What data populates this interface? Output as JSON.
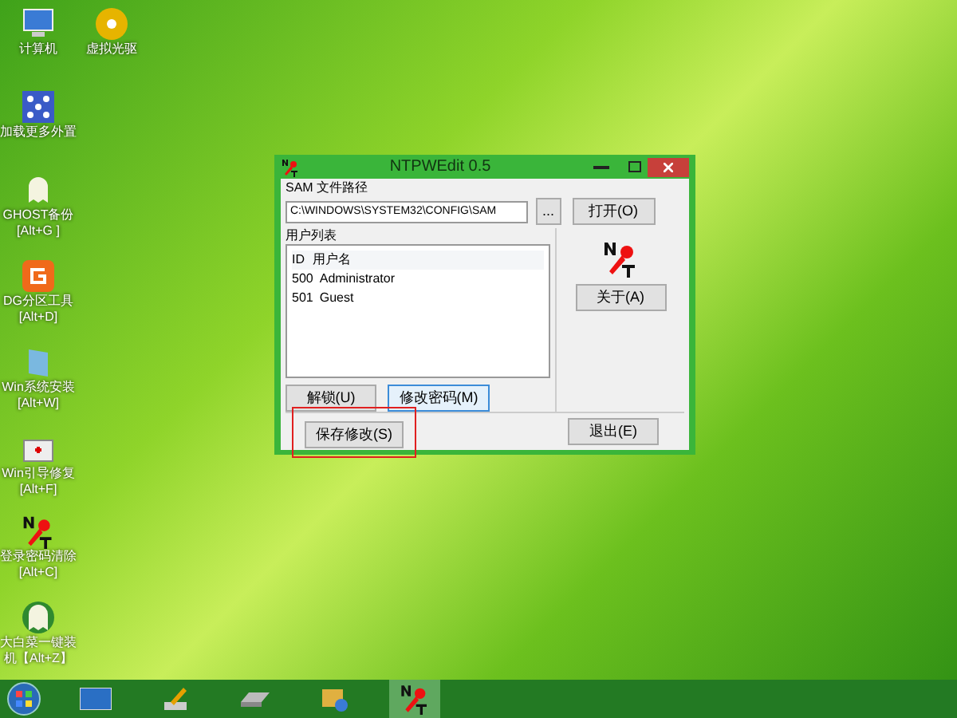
{
  "desktop_icons": [
    {
      "kind": "computer",
      "lines": [
        "计算机"
      ]
    },
    {
      "kind": "disc",
      "lines": [
        "虚拟光驱"
      ]
    },
    {
      "kind": "grid",
      "lines": [
        "加载更多外置"
      ]
    },
    {
      "kind": "ghost",
      "lines": [
        "GHOST备份",
        "[Alt+G ]"
      ]
    },
    {
      "kind": "partition",
      "lines": [
        "DG分区工具",
        "[Alt+D]"
      ]
    },
    {
      "kind": "install",
      "lines": [
        "Win系统安装",
        "[Alt+W]"
      ]
    },
    {
      "kind": "repair",
      "lines": [
        "Win引导修复",
        "[Alt+F]"
      ]
    },
    {
      "kind": "ntpw",
      "lines": [
        "登录密码清除",
        "[Alt+C]"
      ]
    },
    {
      "kind": "ghost2",
      "lines": [
        "大白菜一键装",
        "机【Alt+Z】"
      ]
    }
  ],
  "window": {
    "title": "NTPWEdit 0.5",
    "sam_label": "SAM 文件路径",
    "sam_path": "C:\\WINDOWS\\SYSTEM32\\CONFIG\\SAM",
    "browse": "...",
    "open": "打开(O)",
    "user_list_label": "用户列表",
    "columns": [
      "ID",
      "用户名"
    ],
    "rows": [
      {
        "id": "500",
        "name": "Administrator"
      },
      {
        "id": "501",
        "name": "Guest"
      }
    ],
    "unlock": "解锁(U)",
    "change_password": {
      "label": "修改密码(M)",
      "focused": true
    },
    "about": "关于(A)",
    "save": {
      "label": "保存修改(S)",
      "highlighted": true
    },
    "exit": "退出(E)"
  },
  "taskbar": [
    {
      "kind": "screen",
      "selected": false
    },
    {
      "kind": "brush",
      "selected": false
    },
    {
      "kind": "drive",
      "selected": false
    },
    {
      "kind": "tools",
      "selected": false
    },
    {
      "kind": "ntpw",
      "selected": true
    }
  ]
}
